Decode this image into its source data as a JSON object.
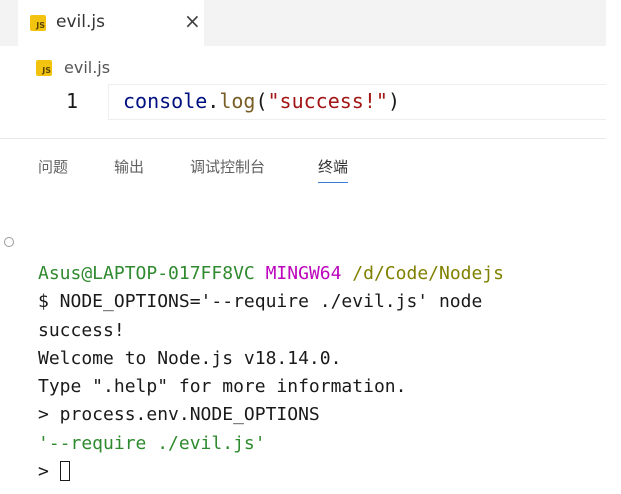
{
  "editor": {
    "tab": {
      "icon": "js-file-icon",
      "label": "evil.js",
      "close_symbol": "×"
    },
    "breadcrumb": {
      "icon": "js-file-icon",
      "label": "evil.js"
    },
    "icon_text": "JS",
    "code": {
      "line_number": "1",
      "tokens": {
        "object": "console",
        "dot": ".",
        "method": "log",
        "open_paren": "(",
        "string": "\"success!\"",
        "close_paren": ")"
      }
    }
  },
  "panel": {
    "tabs": [
      {
        "label": "问题",
        "active": false
      },
      {
        "label": "输出",
        "active": false
      },
      {
        "label": "调试控制台",
        "active": false
      },
      {
        "label": "终端",
        "active": true
      }
    ]
  },
  "terminal": {
    "prompt": {
      "user_host": "Asus@LAPTOP-017FF8VC",
      "env": "MINGW64",
      "path": "/d/Code/Nodejs"
    },
    "command": "$ NODE_OPTIONS='--require ./evil.js' node",
    "output_lines": [
      "success!",
      "Welcome to Node.js v18.14.0.",
      "Type \".help\" for more information.",
      "> process.env.NODE_OPTIONS"
    ],
    "result_value": "'--require ./evil.js'",
    "repl_prompt": ">"
  },
  "colors": {
    "tab_bar_bg": "#f3f3f3",
    "js_badge": "#f2c40f",
    "prompt_user": "#2f8a2f",
    "prompt_env": "#bc05bc",
    "prompt_path": "#808000",
    "result_string": "#2f8a2f",
    "active_tab_underline": "#3c7dd4"
  }
}
